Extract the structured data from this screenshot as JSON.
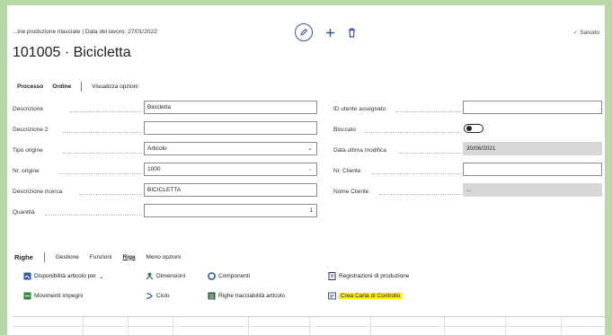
{
  "header": {
    "breadcrumb": "...ine produzione rilasciate | Data del lavoro: 27/01/2022",
    "status": "Salvato",
    "title": "101005 · Bicicletta"
  },
  "tabs": [
    {
      "label": "Processo"
    },
    {
      "label": "Ordine"
    },
    {
      "label": "Visualizza opzioni"
    }
  ],
  "fields_left": [
    {
      "label": "Descrizione",
      "value": "Bicicletta",
      "kind": "text"
    },
    {
      "label": "Descrizione 2",
      "value": "",
      "kind": "text"
    },
    {
      "label": "Tipo origine",
      "value": "Articolo",
      "kind": "select"
    },
    {
      "label": "Nr. origine",
      "value": "1000",
      "kind": "combo"
    },
    {
      "label": "Descrizione ricerca",
      "value": "BICICLETTA",
      "kind": "text"
    },
    {
      "label": "Quantità",
      "value": "1",
      "kind": "number"
    }
  ],
  "fields_right": [
    {
      "label": "ID utente assegnato",
      "value": "",
      "kind": "text"
    },
    {
      "label": "Bloccato",
      "value": "",
      "kind": "toggle"
    },
    {
      "label": "Data ultima modifica",
      "value": "30/06/2021",
      "kind": "readonly"
    },
    {
      "label": "Nr. Cliente",
      "value": "",
      "kind": "text"
    },
    {
      "label": "Nome Cliente",
      "value": "...",
      "kind": "readonly"
    }
  ],
  "lines": {
    "title": "Righe",
    "tabs": [
      "Gestione",
      "Funzioni",
      "Riga",
      "Meno opzioni"
    ],
    "actions": [
      {
        "label": "Disponibilità articolo per",
        "icon": "availability-icon",
        "chevron": "⌄"
      },
      {
        "label": "Dimensioni",
        "icon": "dimensions-icon"
      },
      {
        "label": "Componenti",
        "icon": "components-icon"
      },
      {
        "label": "Registrazioni di produzione",
        "icon": "journal-icon"
      },
      {
        "label": "Movimenti impegni",
        "icon": "reservation-icon"
      },
      {
        "label": "Ciclo",
        "icon": "routing-icon"
      },
      {
        "label": "Righe tracciabilità articolo",
        "icon": "tracking-icon"
      },
      {
        "label": "Crea Carta di Controllo",
        "icon": "control-card-icon"
      }
    ]
  },
  "colors": {
    "accent": "#2d5aa8",
    "highlight": "#fff200",
    "frame": "#b8d9a6"
  }
}
